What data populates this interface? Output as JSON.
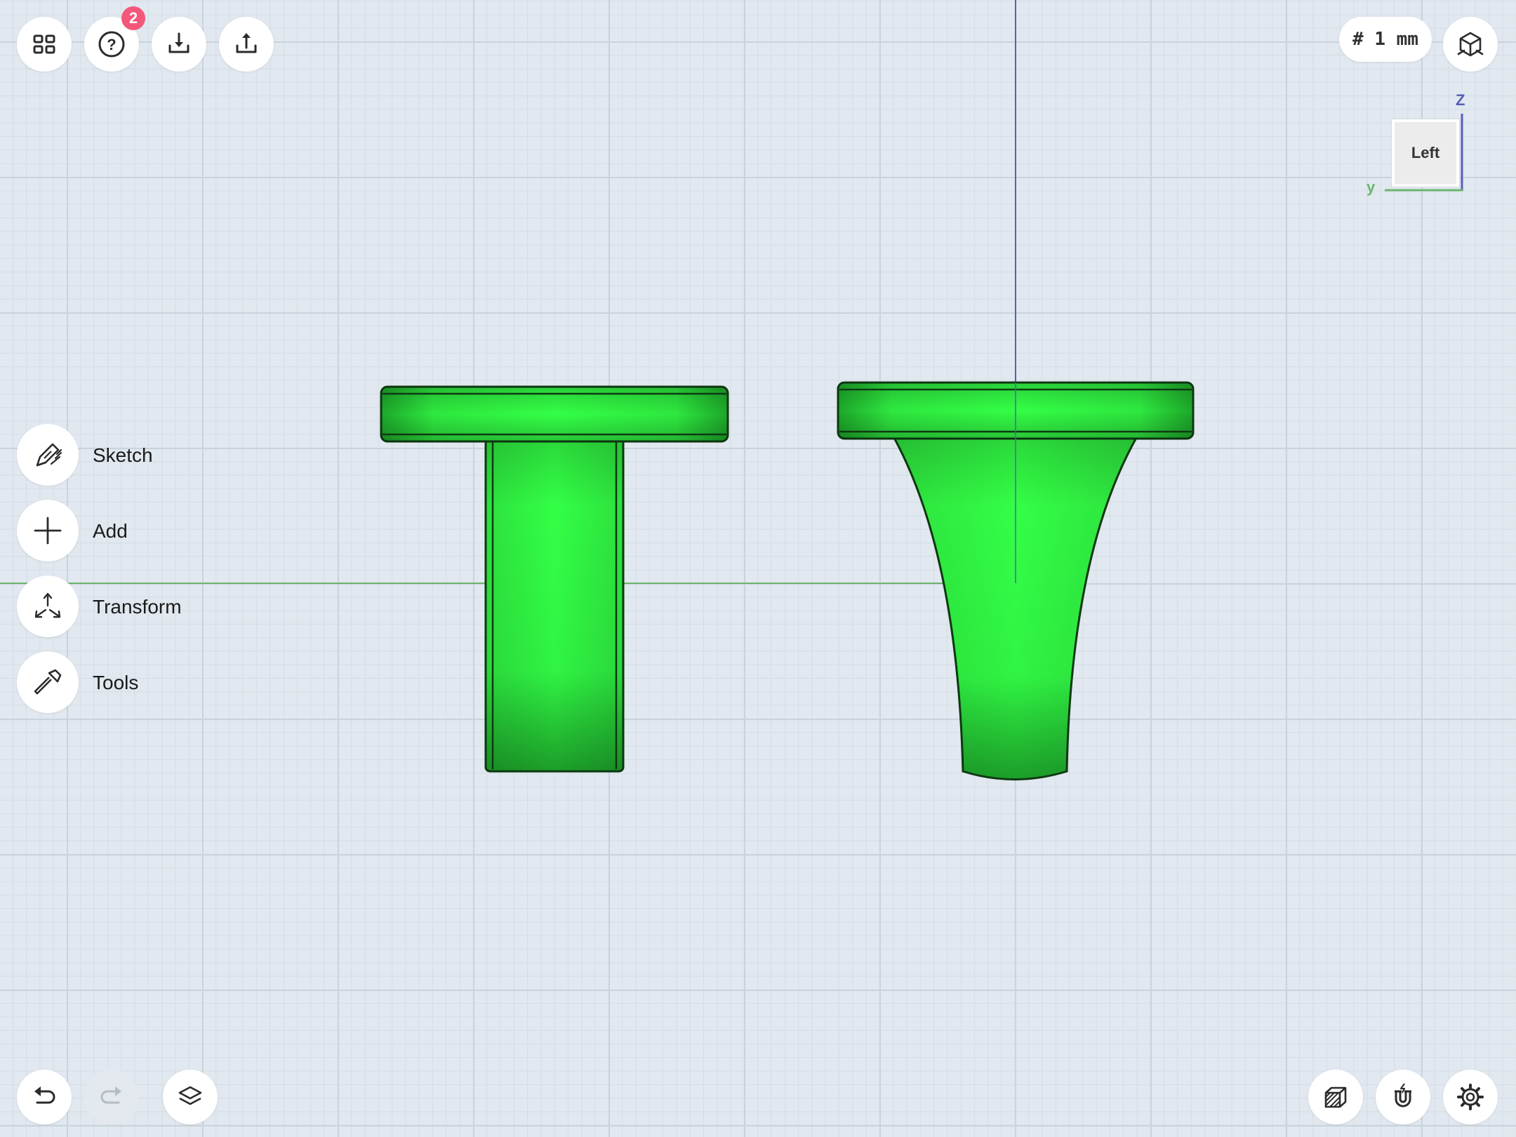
{
  "toolbar_top": {
    "help_badge_count": "2",
    "grid_units": "# 1 mm"
  },
  "tools": [
    {
      "label": "Sketch",
      "icon": "sketch-icon"
    },
    {
      "label": "Add",
      "icon": "plus-icon"
    },
    {
      "label": "Transform",
      "icon": "transform-icon"
    },
    {
      "label": "Tools",
      "icon": "hammer-icon"
    }
  ],
  "view_cube": {
    "face_label": "Left",
    "axis_z_label": "Z",
    "axis_y_label": "y"
  },
  "colors": {
    "badge": "#f4577a",
    "axis_z": "#5560b8",
    "axis_y": "#6cb56c",
    "model_green": "#2ffc42",
    "model_edge": "#0e3a12",
    "icon_dark": "#2b2b2b"
  }
}
